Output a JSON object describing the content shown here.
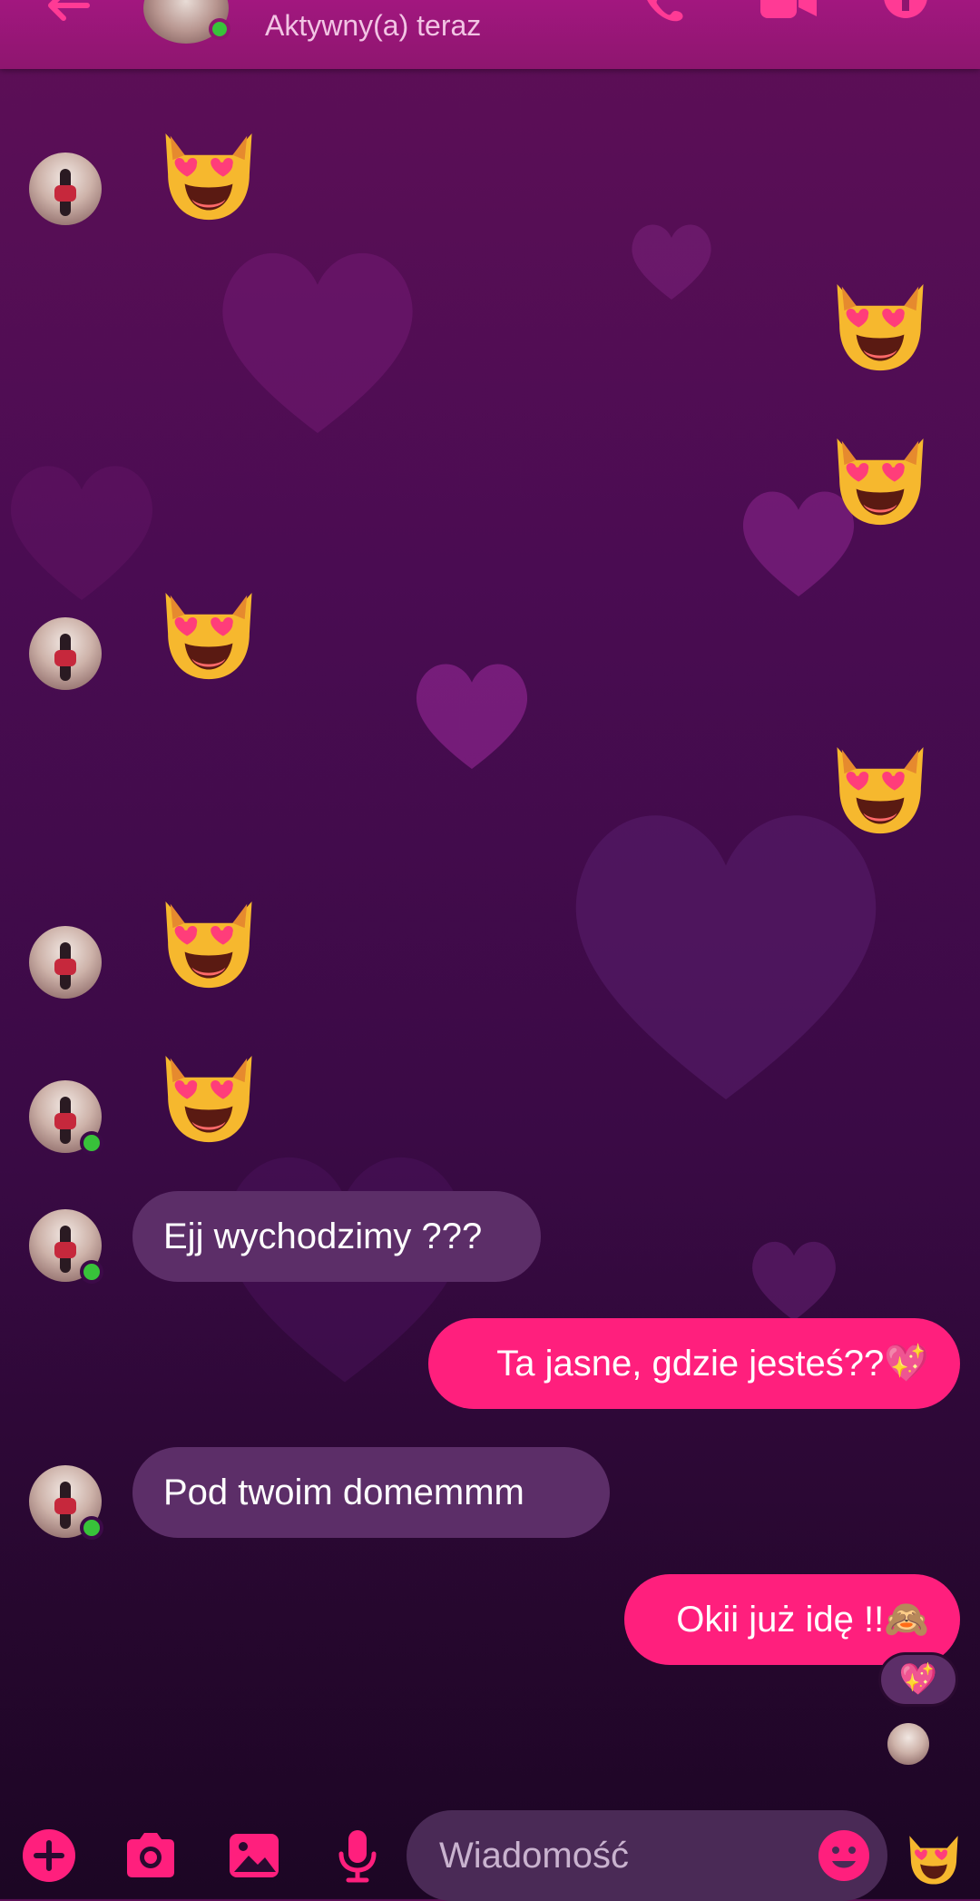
{
  "header": {
    "status": "Aktywny(a) teraz"
  },
  "messages": [
    {
      "side": "in",
      "type": "emoji",
      "emoji": "smiling-cat-heart-eyes"
    },
    {
      "side": "out",
      "type": "emoji",
      "emoji": "smiling-cat-heart-eyes"
    },
    {
      "side": "out",
      "type": "emoji",
      "emoji": "smiling-cat-heart-eyes"
    },
    {
      "side": "in",
      "type": "emoji",
      "emoji": "smiling-cat-heart-eyes"
    },
    {
      "side": "out",
      "type": "emoji",
      "emoji": "smiling-cat-heart-eyes"
    },
    {
      "side": "in",
      "type": "emoji",
      "emoji": "smiling-cat-heart-eyes"
    },
    {
      "side": "in",
      "type": "emoji",
      "emoji": "smiling-cat-heart-eyes"
    },
    {
      "side": "in",
      "type": "text",
      "text": "Ejj wychodzimy ???"
    },
    {
      "side": "out",
      "type": "text",
      "text": "Ta jasne, gdzie jesteś??💖"
    },
    {
      "side": "in",
      "type": "text",
      "text": "Pod twoim domemmm"
    },
    {
      "side": "out",
      "type": "text",
      "text": "Okii już idę !!🙈",
      "reaction": "💖"
    }
  ],
  "composer": {
    "placeholder": "Wiadomość",
    "icons": [
      "plus-icon",
      "camera-icon",
      "image-icon",
      "microphone-icon",
      "emoji-icon",
      "cat-heart-eyes-icon"
    ]
  },
  "colors": {
    "accent": "#ff1f7d",
    "header": "#8e166f",
    "incoming_bubble": "#5c2e68",
    "online": "#38c23a"
  }
}
